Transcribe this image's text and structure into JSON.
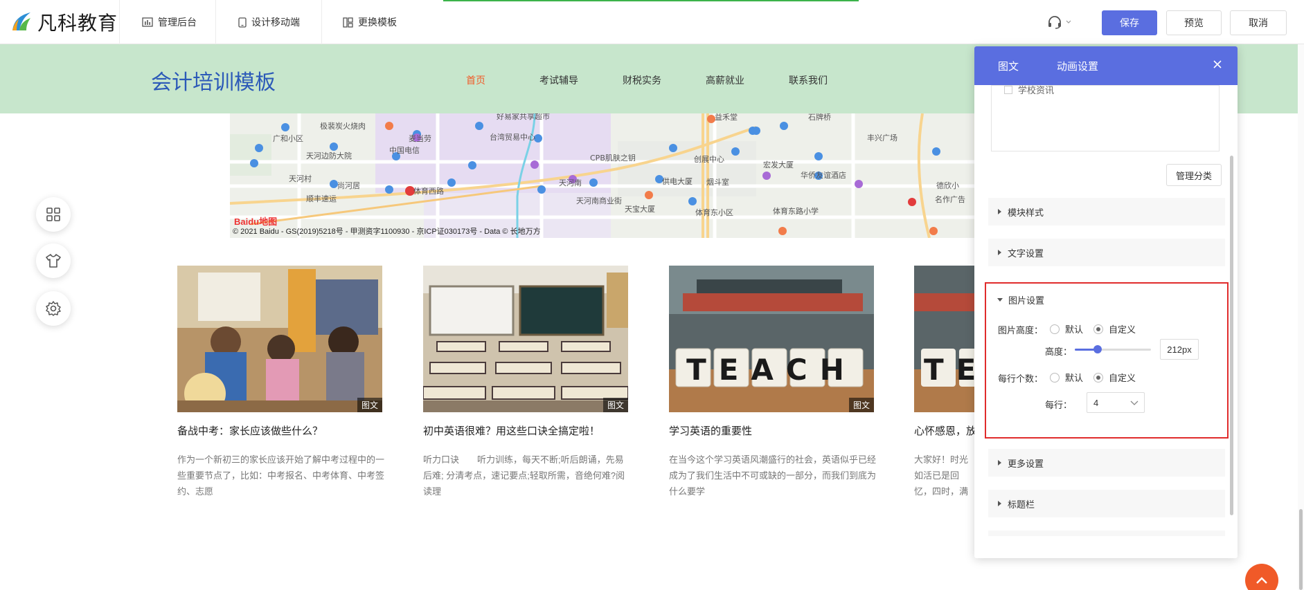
{
  "header": {
    "logo_text": "凡科教育",
    "nav": [
      {
        "label": "管理后台",
        "icon": "bar-chart-icon"
      },
      {
        "label": "设计移动端",
        "icon": "mobile-icon"
      },
      {
        "label": "更换模板",
        "icon": "template-icon"
      }
    ],
    "save_label": "保存",
    "preview_label": "预览",
    "cancel_label": "取消",
    "accent": "#5a6ee0"
  },
  "site": {
    "title": "会计培训模板",
    "nav": [
      "首页",
      "考试辅导",
      "财税实务",
      "高薪就业",
      "联系我们"
    ],
    "active_nav": "首页",
    "banner_color": "#c7e6cc"
  },
  "map": {
    "credit": "© 2021 Baidu - GS(2019)5218号 - 甲测资字1100930 - 京ICP证030173号 - Data © 长地万方",
    "logo": "Baidu地图",
    "labels": [
      "极裴炭火烧肉",
      "天河边防大院",
      "中国电信",
      "麦当劳",
      "台湾贸易中心",
      "好易家共享超市",
      "天河南",
      "CPB肌肤之钥",
      "体育西路",
      "尚河居",
      "顺丰速运",
      "广和小区",
      "天河村",
      "天河南商业街",
      "天宝大厦",
      "益禾堂",
      "供电大厦",
      "烟斗室",
      "创展中心",
      "体育东小区",
      "宏发大厦",
      "石牌桥",
      "丰兴广场",
      "华侨友谊酒店",
      "体育东路小学",
      "德欣小",
      "名作广告"
    ]
  },
  "cards": [
    {
      "title": "备战中考：家长应该做些什么？",
      "desc": "作为一个新初三的家长应该开始了解中考过程中的一些重要节点了，比如：中考报名、中考体育、中考签约、志愿",
      "tag": "图文"
    },
    {
      "title": "初中英语很难？用这些口诀全搞定啦！",
      "desc": "听力口诀　　听力训练，每天不断;听后朗诵，先易后难; 分清考点，速记要点;轻取所需，音绝何难?阅读理",
      "tag": "图文"
    },
    {
      "title": "学习英语的重要性",
      "desc": "在当今这个学习英语风潮盛行的社会，英语似乎已经成为了我们生活中不可或缺的一部分，而我们到底为什么要学",
      "tag": "图文",
      "img_text": "TEACH"
    },
    {
      "title": "心怀感恩，放",
      "desc": "大家好！时光如活已是回忆，四时，满是好奇，",
      "img_text": "TE"
    }
  ],
  "side_tools": [
    "grid-icon",
    "shirt-icon",
    "settings-icon"
  ],
  "panel": {
    "tabs": [
      "图文",
      "动画设置"
    ],
    "category_item": "学校资讯",
    "manage_label": "管理分类",
    "sections": {
      "module_style": "模块样式",
      "text_settings": "文字设置",
      "image_settings": "图片设置",
      "more_settings": "更多设置",
      "title_bar": "标题栏"
    },
    "image_height_label": "图片高度：",
    "default_label": "默认",
    "custom_label": "自定义",
    "height_label": "高度：",
    "height_value": "212px",
    "height_slider_fraction": 0.3,
    "per_row_label": "每行个数：",
    "row_label": "每行：",
    "row_value": "4"
  }
}
